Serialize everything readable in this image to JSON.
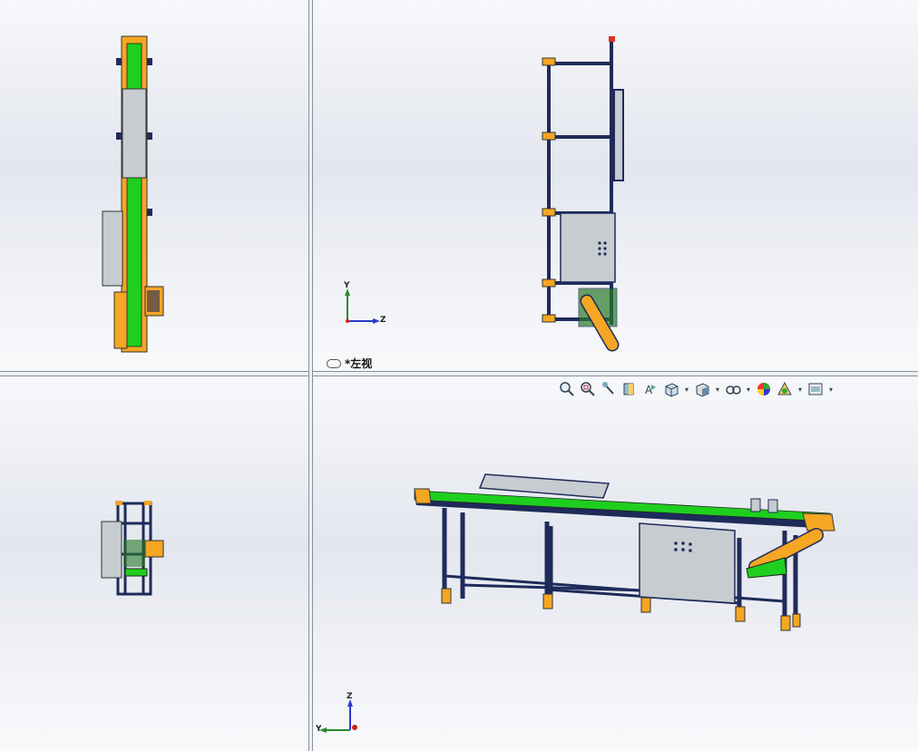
{
  "viewports": {
    "top_left": {
      "name": ""
    },
    "top_right": {
      "view_label": "*左视",
      "triad_y": "Y",
      "triad_z": "Z"
    },
    "bottom_left": {
      "name": ""
    },
    "bottom_right": {
      "triad_z": "Z",
      "triad_y": "Y"
    }
  },
  "heads_up_toolbar": {
    "icons": [
      "zoom-to-fit-icon",
      "zoom-to-area-icon",
      "previous-view-icon",
      "section-view-icon",
      "dynamic-annotation-icon",
      "view-orientation-icon",
      "display-style-icon",
      "hide-show-items-icon",
      "edit-appearance-icon",
      "apply-scene-icon",
      "view-settings-icon"
    ]
  },
  "colors": {
    "frame": "#1e2b5a",
    "belt": "#1fcf1f",
    "rail": "#f5a623",
    "cabinet": "#c7ccd0",
    "background": "#eceef3"
  }
}
